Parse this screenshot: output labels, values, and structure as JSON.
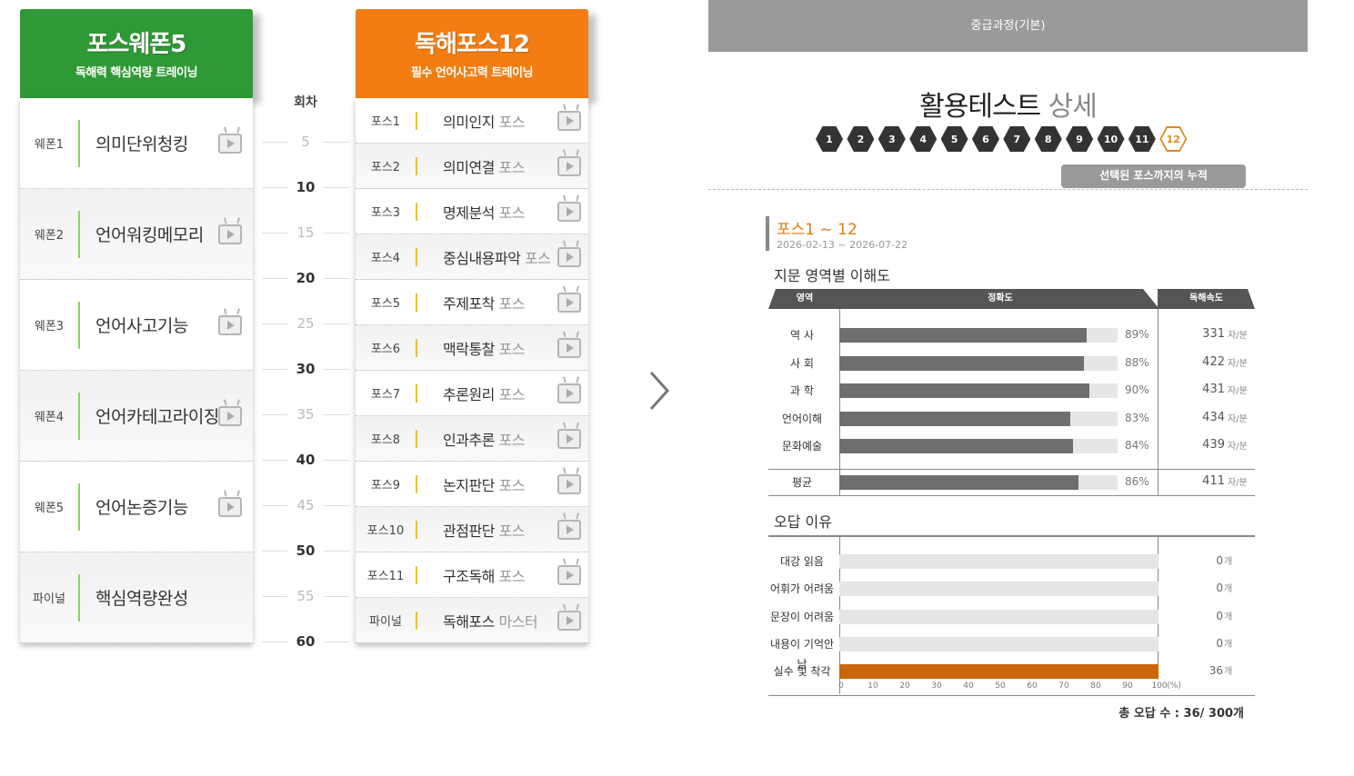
{
  "weapon": {
    "title": "포스웨폰5",
    "subtitle": "독해력 핵심역량 트레이닝",
    "items": [
      {
        "label": "웨폰1",
        "name": "의미단위청킹"
      },
      {
        "label": "웨폰2",
        "name": "언어워킹메모리"
      },
      {
        "label": "웨폰3",
        "name": "언어사고기능"
      },
      {
        "label": "웨폰4",
        "name": "언어카테고라이징"
      },
      {
        "label": "웨폰5",
        "name": "언어논증기능"
      },
      {
        "label": "파이널",
        "name": "핵심역량완성"
      }
    ]
  },
  "scale": {
    "header": "회차",
    "ticks": [
      "5",
      "10",
      "15",
      "20",
      "25",
      "30",
      "35",
      "40",
      "45",
      "50",
      "55",
      "60"
    ]
  },
  "pos": {
    "title": "독해포스12",
    "subtitle": "필수 언어사고력 트레이닝",
    "items": [
      {
        "label": "포스1",
        "name": "의미인지",
        "suffix": "포스"
      },
      {
        "label": "포스2",
        "name": "의미연결",
        "suffix": "포스"
      },
      {
        "label": "포스3",
        "name": "명제분석",
        "suffix": "포스"
      },
      {
        "label": "포스4",
        "name": "중심내용파악",
        "suffix": "포스"
      },
      {
        "label": "포스5",
        "name": "주제포착",
        "suffix": "포스"
      },
      {
        "label": "포스6",
        "name": "맥락통찰",
        "suffix": "포스"
      },
      {
        "label": "포스7",
        "name": "추론원리",
        "suffix": "포스"
      },
      {
        "label": "포스8",
        "name": "인과추론",
        "suffix": "포스"
      },
      {
        "label": "포스9",
        "name": "논지판단",
        "suffix": "포스"
      },
      {
        "label": "포스10",
        "name": "관점판단",
        "suffix": "포스"
      },
      {
        "label": "포스11",
        "name": "구조독해",
        "suffix": "포스"
      },
      {
        "label": "파이널",
        "name": "독해포스",
        "suffix": "마스터"
      }
    ]
  },
  "detail": {
    "course": "중급과정(기본)",
    "title_main": "활용테스트",
    "title_sub": "상세",
    "steps": [
      "1",
      "2",
      "3",
      "4",
      "5",
      "6",
      "7",
      "8",
      "9",
      "10",
      "11",
      "12"
    ],
    "selected_step": "12",
    "tooltip": "선택된 포스까지의 누적",
    "range_title": "포스1 ~ 12",
    "range_dates": "2026-02-13 ~ 2026-07-22",
    "section1": "지문 영역별 이해도",
    "col_area": "영역",
    "col_accuracy": "정확도",
    "col_speed": "독해속도",
    "rows": [
      {
        "area": "역    사",
        "accuracy": 89,
        "pct": "89%",
        "speed": "331",
        "unit": "자/분"
      },
      {
        "area": "사    회",
        "accuracy": 88,
        "pct": "88%",
        "speed": "422",
        "unit": "자/분"
      },
      {
        "area": "과    학",
        "accuracy": 90,
        "pct": "90%",
        "speed": "431",
        "unit": "자/분"
      },
      {
        "area": "언어이해",
        "accuracy": 83,
        "pct": "83%",
        "speed": "434",
        "unit": "자/분"
      },
      {
        "area": "문화예술",
        "accuracy": 84,
        "pct": "84%",
        "speed": "439",
        "unit": "자/분"
      }
    ],
    "average": {
      "area": "평균",
      "accuracy": 86,
      "pct": "86%",
      "speed": "411",
      "unit": "자/분"
    },
    "section2": "오답 이유",
    "wrong": [
      {
        "reason": "대강 읽음",
        "percent": 0,
        "count": "0",
        "unit": "개"
      },
      {
        "reason": "어휘가 어려움",
        "percent": 0,
        "count": "0",
        "unit": "개"
      },
      {
        "reason": "문장이 어려움",
        "percent": 0,
        "count": "0",
        "unit": "개"
      },
      {
        "reason": "내용이 기억안남",
        "percent": 0,
        "count": "0",
        "unit": "개"
      },
      {
        "reason": "실수 및 착각",
        "percent": 100,
        "count": "36",
        "unit": "개"
      }
    ],
    "axis_ticks": [
      "0",
      "10",
      "20",
      "30",
      "40",
      "50",
      "60",
      "70",
      "80",
      "90",
      "100"
    ],
    "axis_unit": "(%)",
    "total": "총 오답 수 : 36/ 300개"
  },
  "colors": {
    "weapon_green": "#2f9a35",
    "pos_orange": "#f37d12",
    "bar_gray": "#6e6e6e",
    "wrong_orange": "#c9650a"
  }
}
